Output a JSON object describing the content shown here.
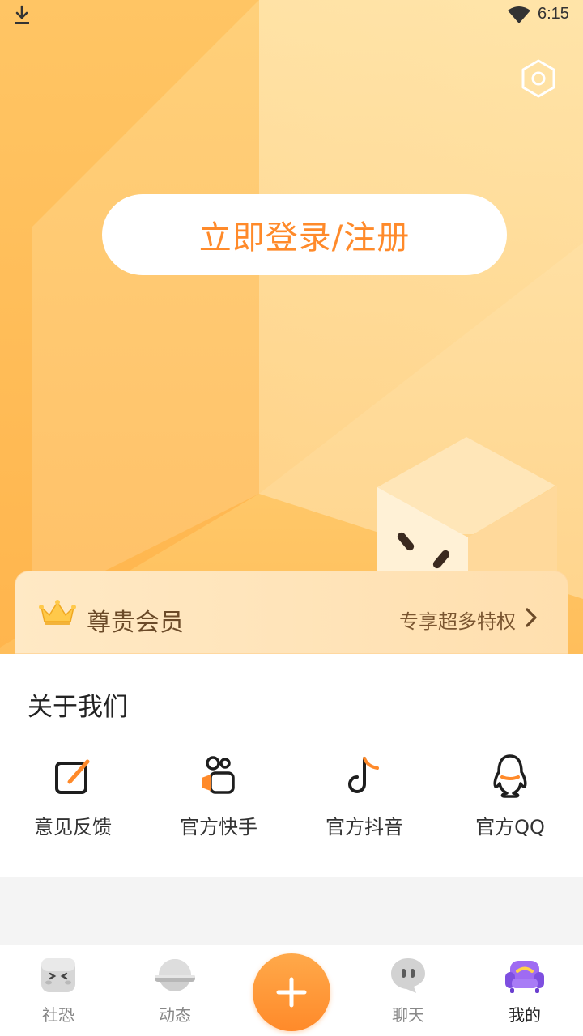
{
  "status_bar": {
    "time": "6:15",
    "download_icon": "download-icon",
    "wifi_icon": "wifi-icon"
  },
  "header": {
    "settings_icon": "settings-hex-icon",
    "login_label": "立即登录/注册"
  },
  "vip": {
    "title": "尊贵会员",
    "link_label": "专享超多特权"
  },
  "about": {
    "title": "关于我们",
    "items": [
      {
        "label": "意见反馈",
        "icon": "feedback-edit-icon"
      },
      {
        "label": "官方快手",
        "icon": "kuaishou-icon"
      },
      {
        "label": "官方抖音",
        "icon": "douyin-icon"
      },
      {
        "label": "官方QQ",
        "icon": "qq-icon"
      }
    ]
  },
  "bottom_nav": {
    "items": [
      {
        "label": "社恐",
        "icon": "shy-cube-icon"
      },
      {
        "label": "动态",
        "icon": "planet-icon"
      },
      {
        "label": "聊天",
        "icon": "chat-bubble-icon"
      },
      {
        "label": "我的",
        "icon": "sofa-icon",
        "active": true
      }
    ],
    "add_icon": "plus-icon"
  },
  "colors": {
    "accent": "#ff8a2a",
    "hero_bg": "#ffc66a",
    "vip_text": "#6b4a28"
  }
}
